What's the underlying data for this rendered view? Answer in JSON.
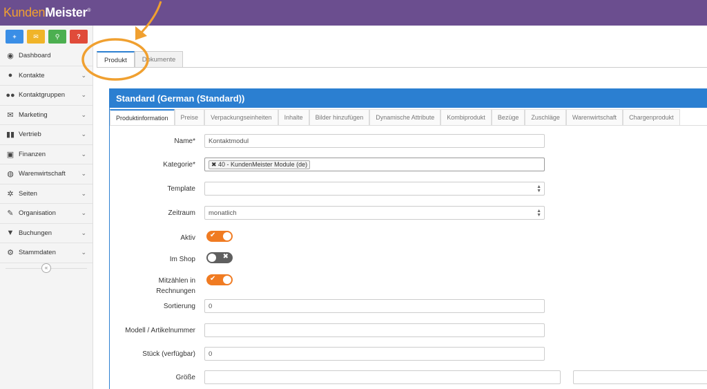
{
  "app": {
    "logo_part1": "Kunden",
    "logo_part2": "Meister",
    "logo_mark": "®"
  },
  "quick_buttons": [
    {
      "icon": "plus-icon",
      "glyph": "+",
      "color": "#3a8ee6"
    },
    {
      "icon": "chat-icon",
      "glyph": "✉",
      "color": "#f0b429"
    },
    {
      "icon": "search-icon",
      "glyph": "⚲",
      "color": "#4caf50"
    },
    {
      "icon": "help-icon",
      "glyph": "?",
      "color": "#e04b3a"
    }
  ],
  "sidebar": {
    "items": [
      {
        "label": "Dashboard",
        "icon": "dashboard-icon",
        "glyph": "◉",
        "has_chevron": false
      },
      {
        "label": "Kontakte",
        "icon": "user-icon",
        "glyph": "●",
        "has_chevron": true
      },
      {
        "label": "Kontaktgruppen",
        "icon": "users-icon",
        "glyph": "●●",
        "has_chevron": true
      },
      {
        "label": "Marketing",
        "icon": "envelope-icon",
        "glyph": "✉",
        "has_chevron": true
      },
      {
        "label": "Vertrieb",
        "icon": "bar-chart-icon",
        "glyph": "▮▮",
        "has_chevron": true
      },
      {
        "label": "Finanzen",
        "icon": "money-icon",
        "glyph": "▣",
        "has_chevron": true
      },
      {
        "label": "Warenwirtschaft",
        "icon": "globe-icon",
        "glyph": "◍",
        "has_chevron": true
      },
      {
        "label": "Seiten",
        "icon": "sitemap-icon",
        "glyph": "✲",
        "has_chevron": true
      },
      {
        "label": "Organisation",
        "icon": "edit-icon",
        "glyph": "✎",
        "has_chevron": true
      },
      {
        "label": "Buchungen",
        "icon": "bookmark-icon",
        "glyph": "▼",
        "has_chevron": true
      },
      {
        "label": "Stammdaten",
        "icon": "gears-icon",
        "glyph": "⚙",
        "has_chevron": true
      }
    ],
    "collapse_glyph": "«"
  },
  "outer_tabs": [
    {
      "label": "Produkt",
      "active": true
    },
    {
      "label": "Dokumente",
      "active": false
    }
  ],
  "panel": {
    "title": "Standard (German (Standard))",
    "tabs": [
      {
        "label": "Produktinformation",
        "active": true
      },
      {
        "label": "Preise"
      },
      {
        "label": "Verpackungseinheiten"
      },
      {
        "label": "Inhalte"
      },
      {
        "label": "Bilder hinzufügen"
      },
      {
        "label": "Dynamische Attribute"
      },
      {
        "label": "Kombiprodukt"
      },
      {
        "label": "Bezüge"
      },
      {
        "label": "Zuschläge"
      },
      {
        "label": "Warenwirtschaft"
      },
      {
        "label": "Chargenprodukt"
      }
    ]
  },
  "form": {
    "name_label": "Name*",
    "name_value": "Kontaktmodul",
    "kategorie_label": "Kategorie*",
    "kategorie_tag": "40 - KundenMeister Module (de)",
    "template_label": "Template",
    "template_value": "",
    "zeitraum_label": "Zeitraum",
    "zeitraum_value": "monatlich",
    "aktiv_label": "Aktiv",
    "aktiv_on": true,
    "imshop_label": "Im Shop",
    "imshop_on": false,
    "mitzaehlen_label": "Mitzählen in Rechnungen",
    "mitzaehlen_on": true,
    "sortierung_label": "Sortierung",
    "sortierung_value": "0",
    "modell_label": "Modell / Artikelnummer",
    "modell_value": "",
    "stueck_label": "Stück (verfügbar)",
    "stueck_value": "0",
    "groesse_label": "Größe",
    "groesse_value1": "",
    "groesse_value2": ""
  },
  "annotation": {
    "color": "#f0a030"
  }
}
